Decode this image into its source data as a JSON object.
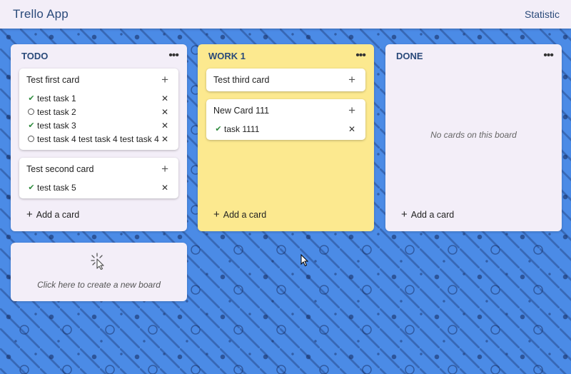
{
  "header": {
    "title": "Trello App",
    "statistic_label": "Statistic"
  },
  "boards": [
    {
      "title": "TODO",
      "cards": [
        {
          "title": "Test first card",
          "tasks": [
            {
              "text": "test task 1",
              "done": true
            },
            {
              "text": "test task 2",
              "done": false
            },
            {
              "text": "test task 3",
              "done": true
            },
            {
              "text": "test task 4 test task 4 test task 4",
              "done": false
            }
          ]
        },
        {
          "title": "Test second card",
          "tasks": [
            {
              "text": "test task 5",
              "done": true
            }
          ]
        }
      ],
      "add_label": "Add a card"
    },
    {
      "title": "WORK 1",
      "cards": [
        {
          "title": "Test third card",
          "tasks": []
        },
        {
          "title": "New Card 111",
          "tasks": [
            {
              "text": "task 1111",
              "done": true
            }
          ]
        }
      ],
      "add_label": "Add a card"
    },
    {
      "title": "DONE",
      "cards": [],
      "empty_text": "No cards on this board",
      "add_label": "Add a card"
    }
  ],
  "new_board": {
    "text": "Click here to create a new board"
  },
  "icons": {
    "check": "✔",
    "plus": "+",
    "close": "✕",
    "more": "•••"
  },
  "colors": {
    "header_bg": "#f3eef8",
    "board_bg": "#f3eef8",
    "work_board_bg": "#fce98f",
    "title_color": "#2a4a7a",
    "check_color": "#2e8b3d",
    "background": "#4b8be6"
  }
}
